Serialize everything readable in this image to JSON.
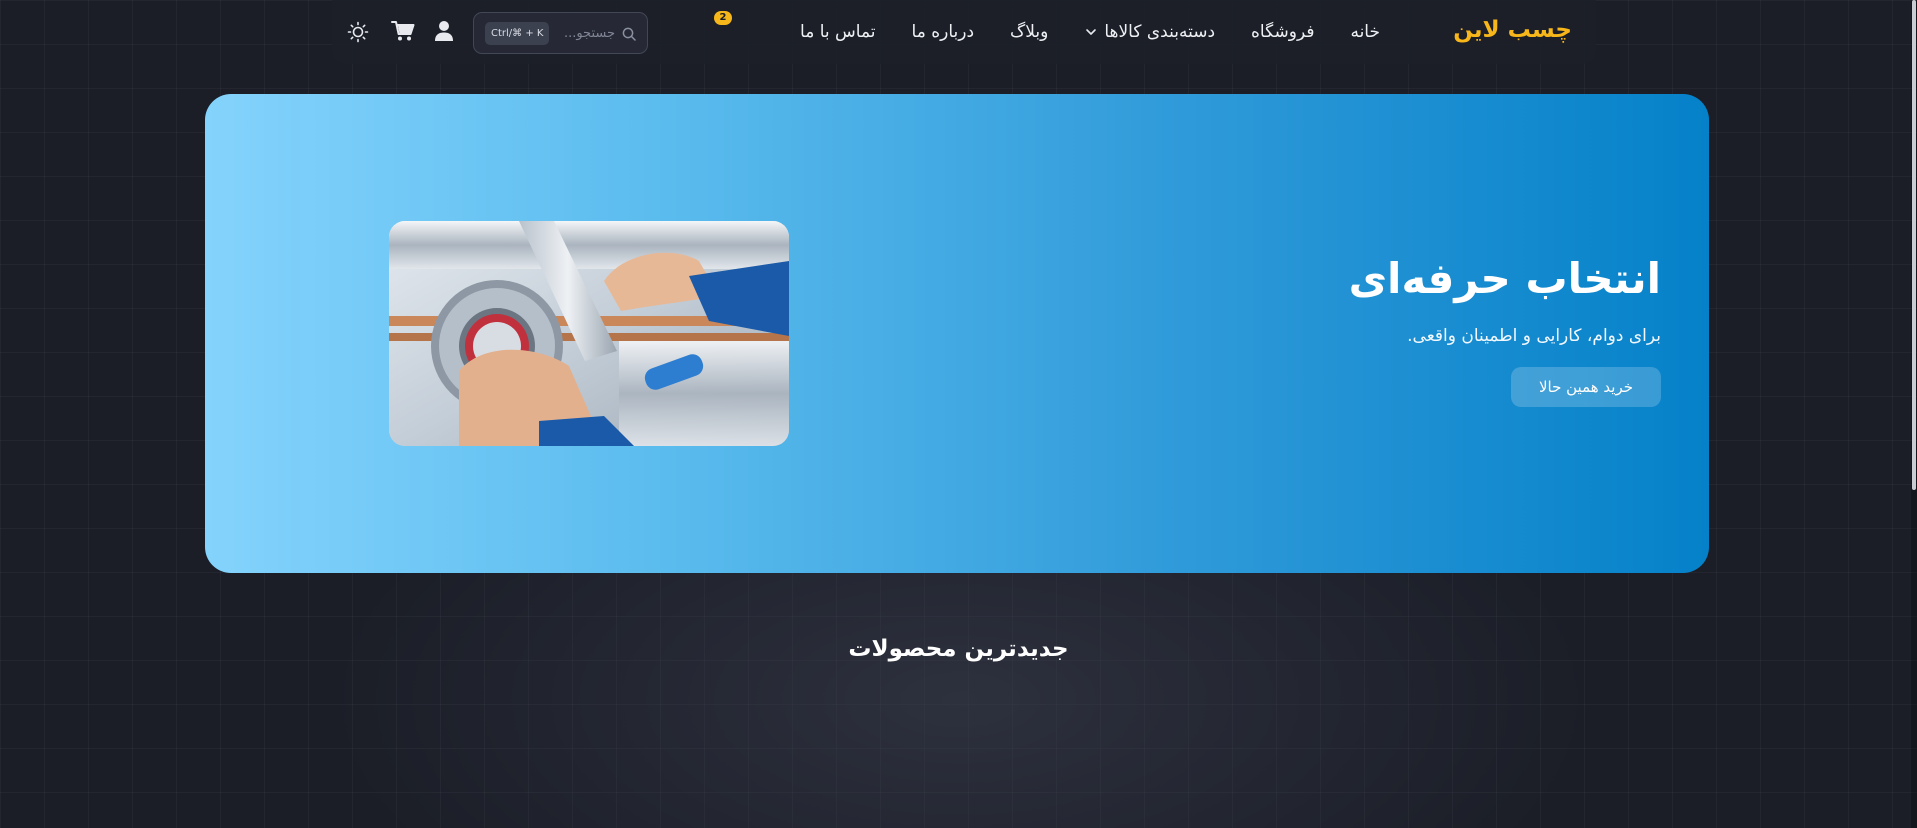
{
  "brand": {
    "logo_text": "چسب لاین",
    "accent_color": "#f7b619"
  },
  "nav": {
    "items": [
      {
        "label": "خانه"
      },
      {
        "label": "فروشگاه"
      },
      {
        "label": "دسته‌بندی کالاها"
      },
      {
        "label": "وبلاگ"
      },
      {
        "label": "درباره ما"
      },
      {
        "label": "تماس با ما"
      }
    ]
  },
  "search": {
    "placeholder": "جستجو...",
    "value": "",
    "shortcut": "Ctrl/⌘ + K"
  },
  "cart": {
    "count": "2"
  },
  "icons": {
    "search": "search-icon",
    "user": "user-icon",
    "cart": "cart-icon",
    "theme": "sun-icon",
    "dropdown": "chevron-down-icon"
  },
  "hero": {
    "title": "انتخاب حرفه‌ای",
    "subtitle": "برای دوام، کارایی و اطمینان واقعی.",
    "cta_label": "خرید همین حالا",
    "gradient_colors": [
      "#84d3fc",
      "#0581c9"
    ]
  },
  "section": {
    "title": "جدیدترین محصولات"
  }
}
